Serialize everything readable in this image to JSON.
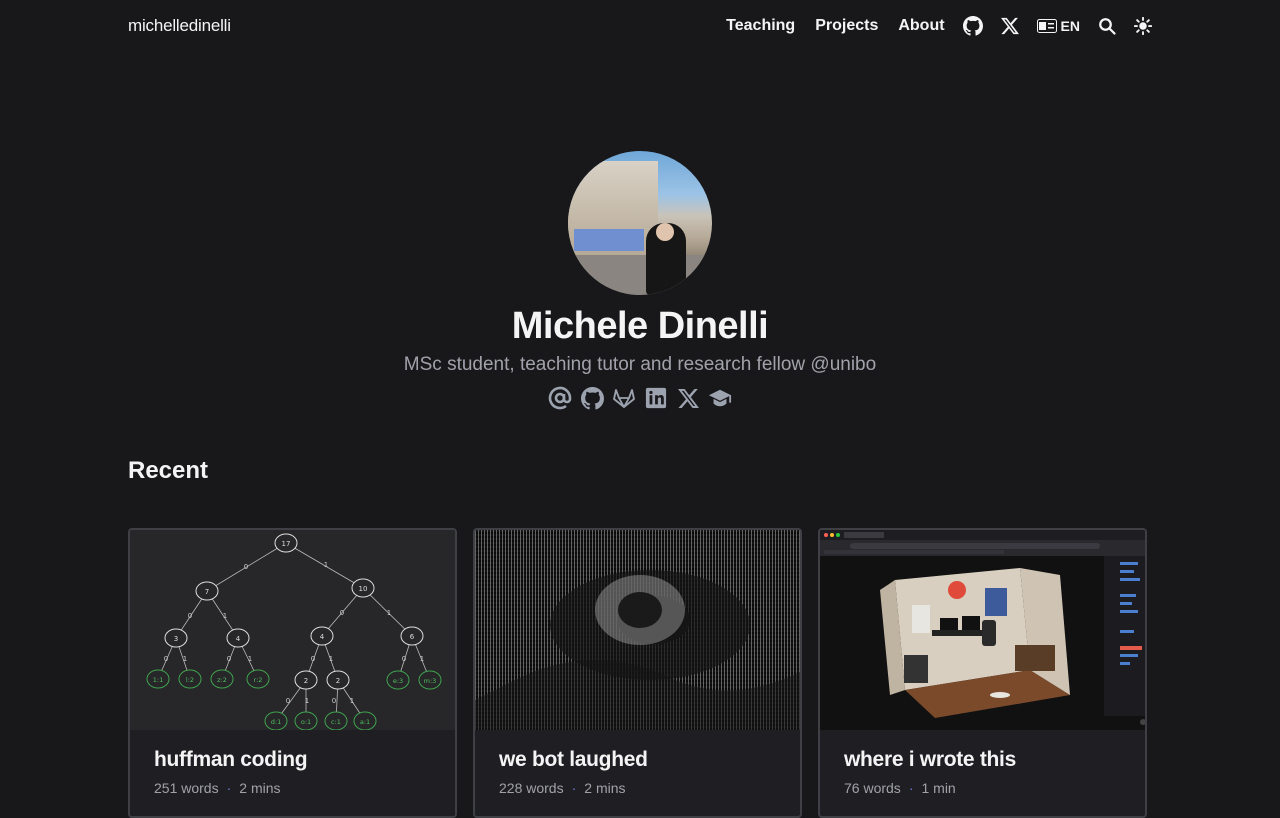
{
  "header": {
    "brand": "michelledinelli",
    "nav": [
      "Teaching",
      "Projects",
      "About"
    ],
    "icons": [
      "github-icon",
      "x-icon",
      "language-icon",
      "search-icon",
      "theme-toggle-icon"
    ],
    "lang": "EN"
  },
  "profile": {
    "name": "Michele Dinelli",
    "tagline": "MSc student, teaching tutor and research fellow @unibo",
    "social_icons": [
      "email-icon",
      "github-icon",
      "gitlab-icon",
      "linkedin-icon",
      "x-icon",
      "scholar-icon"
    ]
  },
  "recent": {
    "title": "Recent",
    "posts": [
      {
        "title": "huffman coding",
        "words": "251 words",
        "time": "2 mins"
      },
      {
        "title": "we bot laughed",
        "words": "228 words",
        "time": "2 mins"
      },
      {
        "title": "where i wrote this",
        "words": "76 words",
        "time": "1 min"
      }
    ]
  },
  "huffman_tree": {
    "nodes": [
      "17",
      "7",
      "10",
      "3",
      "4",
      "4",
      "6",
      "1:1",
      "l:2",
      "z:2",
      "r:2",
      "2",
      "2",
      "e:3",
      "m:3",
      "d:1",
      "o:1",
      "c:1",
      "a:1"
    ],
    "edge_labels": [
      "0",
      "1"
    ]
  }
}
